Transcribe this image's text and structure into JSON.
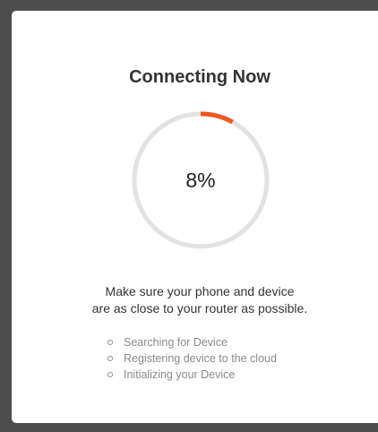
{
  "dialog": {
    "title": "Connecting Now",
    "progress": {
      "percent_label": "8%",
      "value": 0.08,
      "track_color": "#e2e2e2",
      "fill_color": "#f0561d"
    },
    "instruction_line1": "Make sure your phone and device",
    "instruction_line2": "are as close to your router as possible.",
    "steps": [
      "Searching for Device",
      "Registering device to the cloud",
      "Initializing your Device"
    ]
  }
}
